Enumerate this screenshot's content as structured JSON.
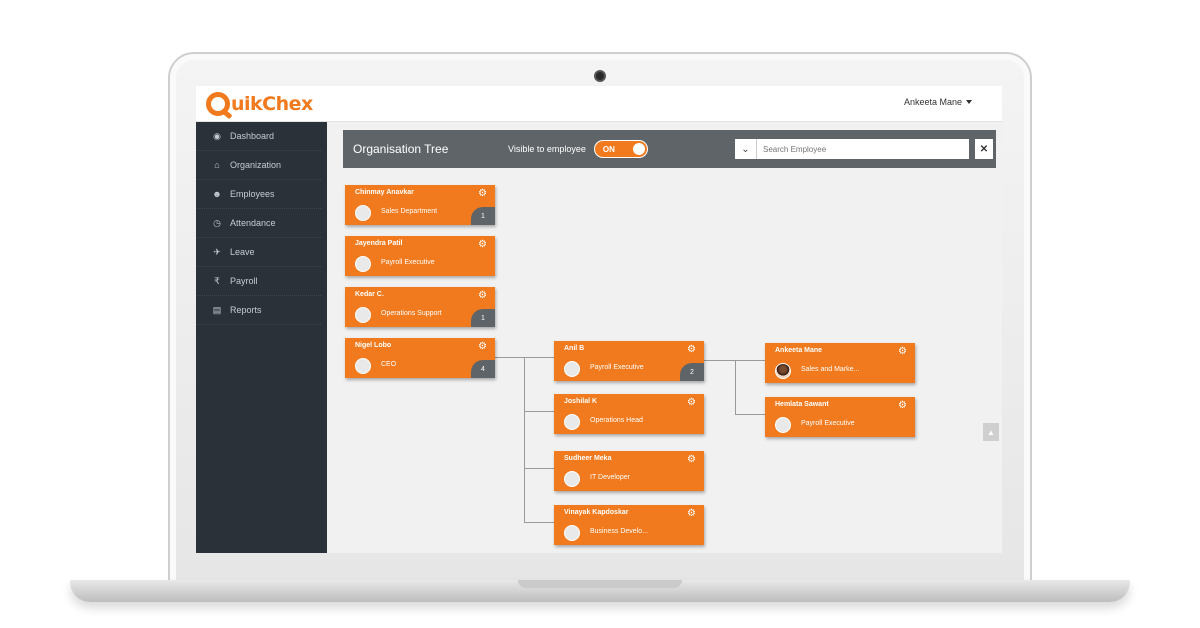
{
  "app": {
    "logo_text": "uikChex",
    "logo_full": "QuikChex",
    "brand_color": "#f07a1d",
    "user_name": "Ankeeta Mane"
  },
  "sidebar": {
    "items": [
      {
        "label": "Dashboard",
        "icon": "dashboard-icon"
      },
      {
        "label": "Organization",
        "icon": "bank-icon"
      },
      {
        "label": "Employees",
        "icon": "users-icon"
      },
      {
        "label": "Attendance",
        "icon": "clock-icon"
      },
      {
        "label": "Leave",
        "icon": "plane-icon"
      },
      {
        "label": "Payroll",
        "icon": "rupee-icon"
      },
      {
        "label": "Reports",
        "icon": "bar-chart-icon"
      }
    ]
  },
  "header": {
    "title": "Organisation Tree",
    "visible_label": "Visible to employee",
    "toggle_value": "ON",
    "search_placeholder": "Search Employee"
  },
  "employees": [
    {
      "name": "Chinmay Anavkar",
      "role": "Sales Department",
      "count": "1"
    },
    {
      "name": "Jayendra Patil",
      "role": "Payroll Executive"
    },
    {
      "name": "Kedar C.",
      "role": "Operations Support",
      "count": "1"
    },
    {
      "name": "Nigel Lobo",
      "role": "CEO",
      "count": "4"
    },
    {
      "name": "Anil B",
      "role": "Payroll Executive",
      "count": "2"
    },
    {
      "name": "Joshilal K",
      "role": "Operations Head"
    },
    {
      "name": "Sudheer Meka",
      "role": "IT Developer"
    },
    {
      "name": "Vinayak Kapdoskar",
      "role": "Business Develo..."
    },
    {
      "name": "Ankeeta Mane",
      "role": "Sales and Marke..."
    },
    {
      "name": "Hemlata Sawant",
      "role": "Payroll Executive"
    }
  ]
}
